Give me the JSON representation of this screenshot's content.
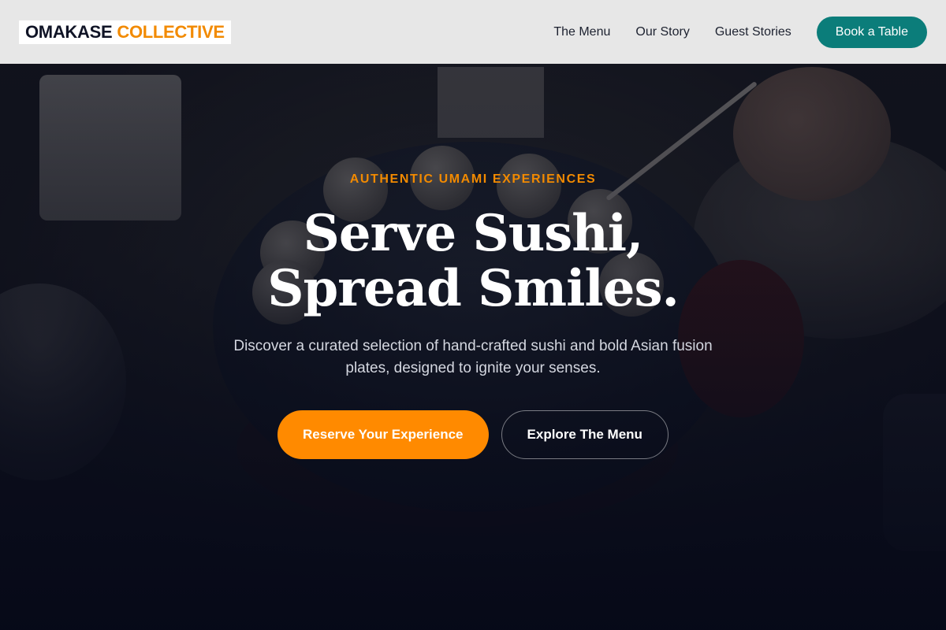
{
  "header": {
    "logo_part1": "OMAKASE",
    "logo_part2": "COLLECTIVE",
    "nav": [
      "The Menu",
      "Our Story",
      "Guest Stories"
    ],
    "cta_label": "Book a Table"
  },
  "hero": {
    "eyebrow": "AUTHENTIC UMAMI EXPERIENCES",
    "headline_line1": "Serve Sushi,",
    "headline_line2": "Spread Smiles.",
    "subtitle": "Discover a curated selection of hand-crafted sushi and bold Asian fusion plates, designed to ignite your senses.",
    "primary_cta": "Reserve Your Experience",
    "secondary_cta": "Explore The Menu"
  },
  "colors": {
    "accent": "#ff8a00",
    "teal": "#0b7d7a",
    "navy": "#101426",
    "header_bg": "#e7e7e7"
  }
}
